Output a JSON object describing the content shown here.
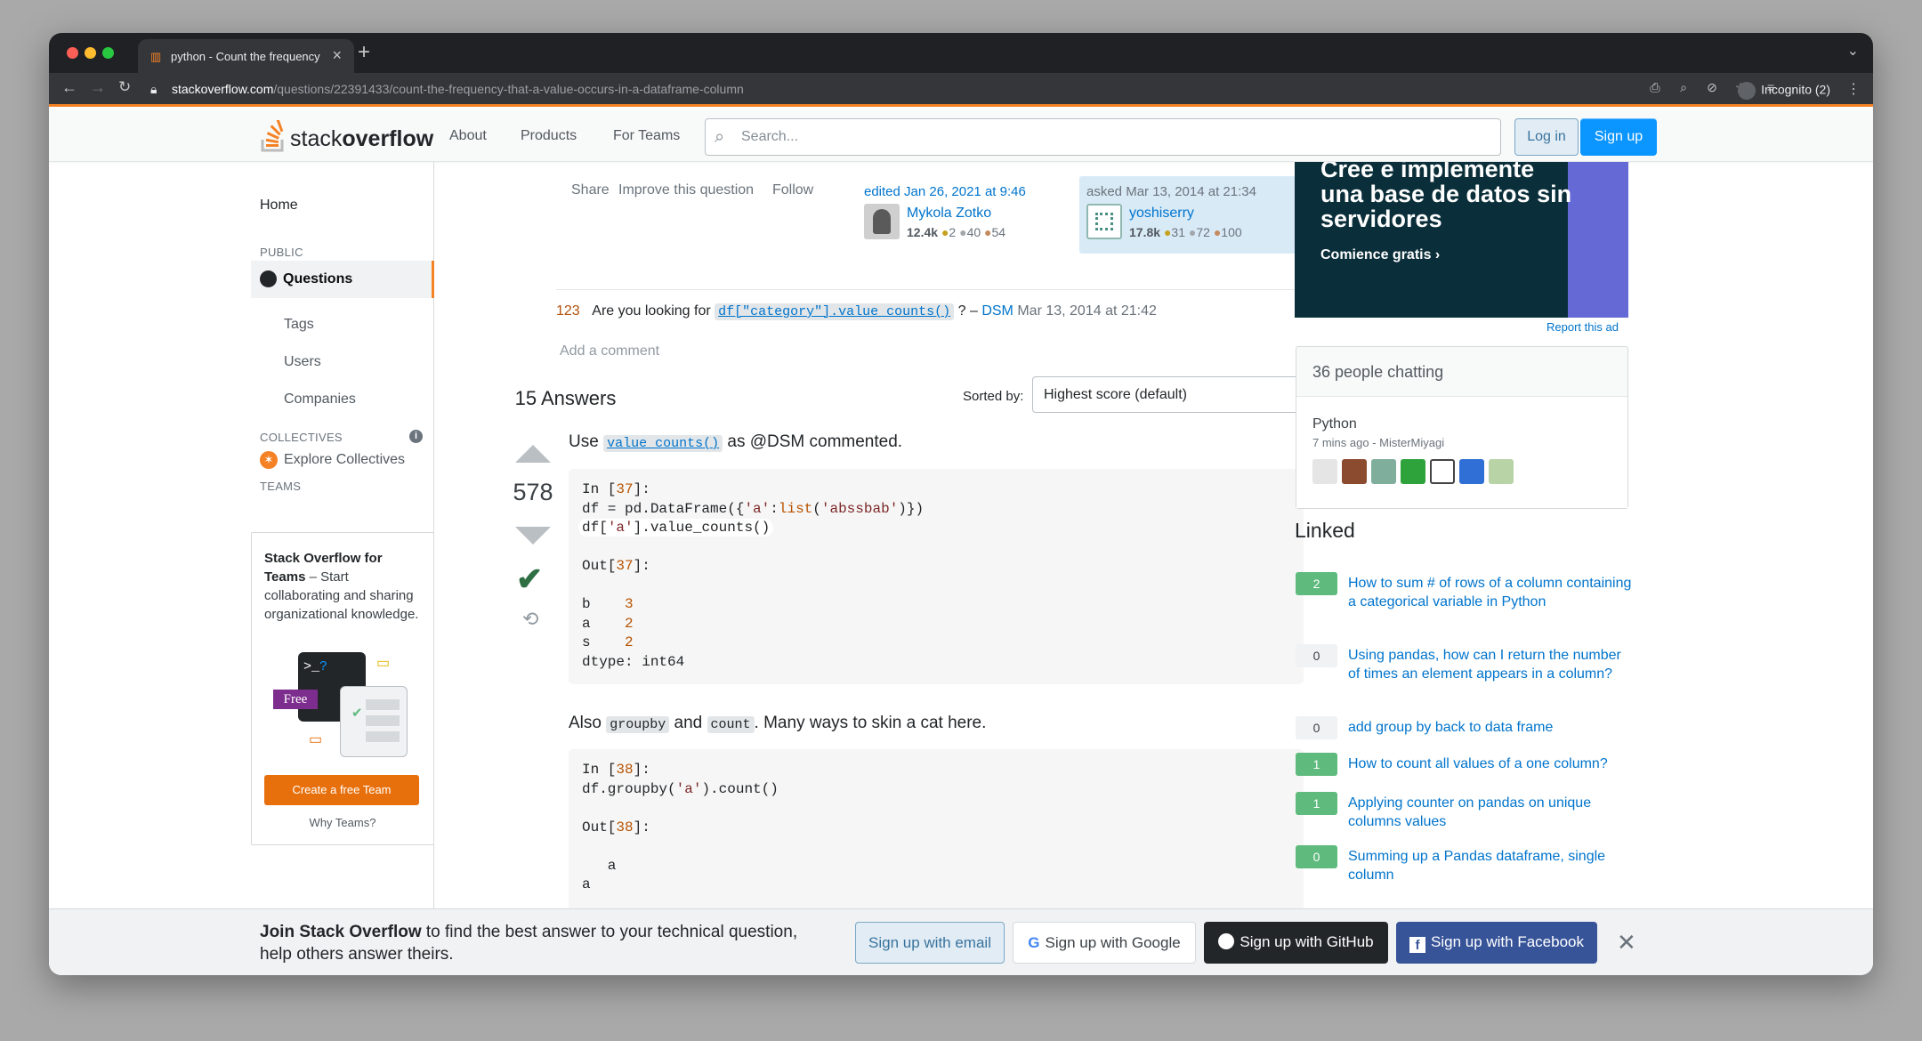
{
  "browser": {
    "tab_title": "python - Count the frequency that a value occurs in a dataframe column",
    "url_host": "stackoverflow.com",
    "url_path": "/questions/22391433/count-the-frequency-that-a-value-occurs-in-a-dataframe-column",
    "incognito": "Incognito (2)"
  },
  "header": {
    "logo_light": "stack",
    "logo_bold": "overflow",
    "nav": [
      "About",
      "Products",
      "For Teams"
    ],
    "search_placeholder": "Search...",
    "login": "Log in",
    "signup": "Sign up"
  },
  "sidebar": {
    "home": "Home",
    "public_heading": "PUBLIC",
    "questions": "Questions",
    "tags": "Tags",
    "users": "Users",
    "companies": "Companies",
    "collectives_heading": "COLLECTIVES",
    "explore_collectives": "Explore Collectives",
    "teams_heading": "TEAMS",
    "teams_title": "Stack Overflow for Teams",
    "teams_text": " – Start collaborating and sharing organizational knowledge.",
    "free": "Free",
    "create_team": "Create a free Team",
    "why_teams": "Why Teams?"
  },
  "question": {
    "share": "Share",
    "improve": "Improve this question",
    "follow": "Follow",
    "edited": {
      "when": "edited Jan 26, 2021 at 9:46",
      "name": "Mykola Zotko",
      "rep": "12.4k",
      "gold": "2",
      "silver": "40",
      "bronze": "54"
    },
    "asked": {
      "when": "asked Mar 13, 2014 at 21:34",
      "name": "yoshiserry",
      "rep": "17.8k",
      "gold": "31",
      "silver": "72",
      "bronze": "100"
    }
  },
  "comment": {
    "score": "123",
    "pre": "Are you looking for",
    "code": "df[\"category\"].value_counts()",
    "post": "? –",
    "user": "DSM",
    "when": "Mar 13, 2014 at 21:42"
  },
  "add_comment": "Add a comment",
  "answers": {
    "count_label": "15 Answers",
    "sorted_by": "Sorted by:",
    "sort_value": "Highest score (default)"
  },
  "answer": {
    "votes": "578",
    "intro_pre": "Use",
    "intro_code": "value_counts()",
    "intro_post": "as @DSM commented.",
    "also_pre": "Also",
    "also_code1": "groupby",
    "also_mid": "and",
    "also_code2": "count",
    "also_post": ". Many ways to skin a cat here."
  },
  "ad": {
    "line1": "Cree e implemente una base de datos sin servidores",
    "cta": "Comience gratis ›",
    "report": "Report this ad"
  },
  "chat": {
    "header": "36 people chatting",
    "room": "Python",
    "sub": "7 mins ago - MisterMiyagi"
  },
  "linked": {
    "heading": "Linked",
    "items": [
      {
        "score": "2",
        "title": "How to sum # of rows of a column containing a categorical variable in Python",
        "accepted": true
      },
      {
        "score": "0",
        "title": "Using pandas, how can I return the number of times an element appears in a column?",
        "accepted": false
      },
      {
        "score": "0",
        "title": "add group by back to data frame",
        "accepted": false
      },
      {
        "score": "1",
        "title": "How to count all values of a one column?",
        "accepted": true
      },
      {
        "score": "1",
        "title": "Applying counter on pandas on unique columns values",
        "accepted": true
      },
      {
        "score": "0",
        "title": "Summing up a Pandas dataframe, single column",
        "accepted": true
      }
    ]
  },
  "banner": {
    "bold": "Join Stack Overflow",
    "text": " to find the best answer to your technical question, help others answer theirs.",
    "email": "Sign up with email",
    "google": "Sign up with Google",
    "github": "Sign up with GitHub",
    "facebook": "Sign up with Facebook"
  }
}
